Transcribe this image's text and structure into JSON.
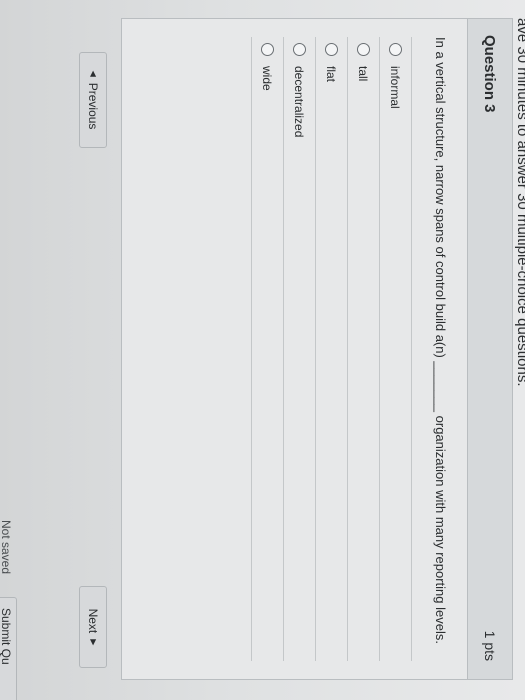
{
  "quiz": {
    "intro_text": "ave 30 minutes to answer 30 multiple-choice questions."
  },
  "question": {
    "title": "Question 3",
    "points": "1 pts",
    "text": "In a vertical structure, narrow spans of control build a(n) _______ organization with many reporting levels.",
    "answers": [
      "informal",
      "tall",
      "flat",
      "decentralized",
      "wide"
    ]
  },
  "navigation": {
    "previous_label": "Previous",
    "previous_icon": "triangle-left-icon",
    "next_label": "Next",
    "next_icon": "triangle-right-icon"
  },
  "footer": {
    "save_status": "Not saved",
    "submit_label": "Submit Qu"
  }
}
